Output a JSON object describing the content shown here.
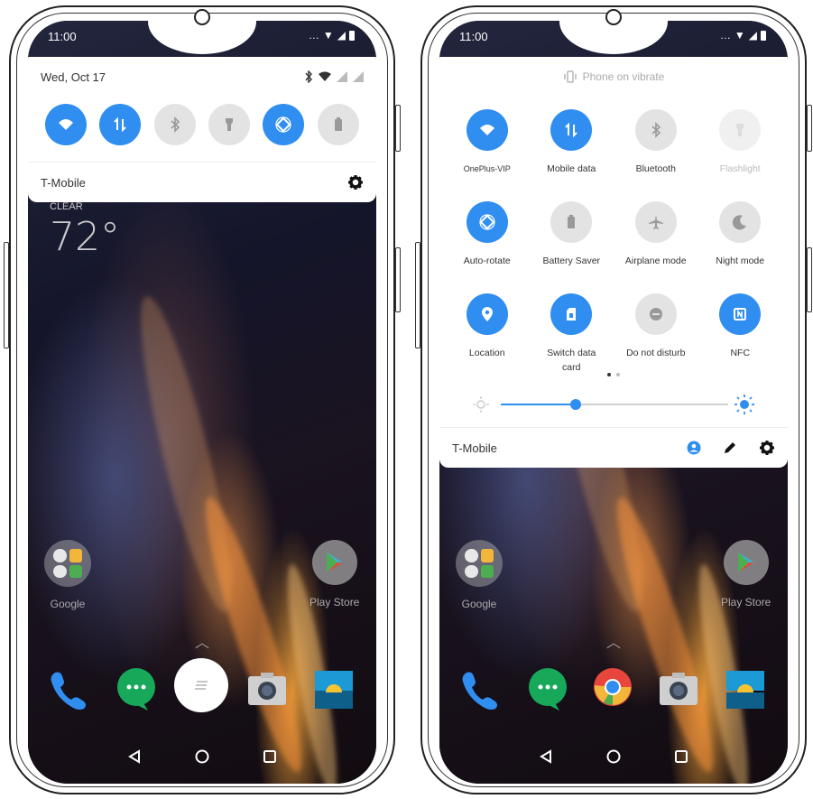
{
  "left_phone": {
    "status": {
      "time": "11:00"
    },
    "panel": {
      "date": "Wed, Oct 17",
      "tiles": [
        {
          "icon": "wifi-icon",
          "state": "on"
        },
        {
          "icon": "mobile-data-icon",
          "state": "on"
        },
        {
          "icon": "bluetooth-icon",
          "state": "off"
        },
        {
          "icon": "flashlight-icon",
          "state": "off"
        },
        {
          "icon": "auto-rotate-icon",
          "state": "on"
        },
        {
          "icon": "battery-saver-icon",
          "state": "off"
        }
      ],
      "carrier": "T-Mobile"
    },
    "weather": {
      "condition": "CLEAR",
      "temp": "72°"
    },
    "home_apps": [
      {
        "label": "Google"
      },
      {
        "label": "Play Store"
      }
    ]
  },
  "right_phone": {
    "status": {
      "time": "11:00"
    },
    "panel": {
      "vibrate_text": "Phone on vibrate",
      "tiles": [
        {
          "label": "OnePlus-VIP",
          "icon": "wifi-icon",
          "state": "on"
        },
        {
          "label": "Mobile data",
          "icon": "mobile-data-icon",
          "state": "on"
        },
        {
          "label": "Bluetooth",
          "icon": "bluetooth-icon",
          "state": "off"
        },
        {
          "label": "Flashlight",
          "icon": "flashlight-icon",
          "state": "dim"
        },
        {
          "label": "Auto-rotate",
          "icon": "auto-rotate-icon",
          "state": "on"
        },
        {
          "label": "Battery Saver",
          "icon": "battery-saver-icon",
          "state": "off"
        },
        {
          "label": "Airplane mode",
          "icon": "airplane-icon",
          "state": "off"
        },
        {
          "label": "Night mode",
          "icon": "night-mode-icon",
          "state": "off"
        },
        {
          "label": "Location",
          "icon": "location-icon",
          "state": "on"
        },
        {
          "label": "Switch data card",
          "icon": "sim-card-icon",
          "state": "on"
        },
        {
          "label": "Do not disturb",
          "icon": "do-not-disturb-icon",
          "state": "off"
        },
        {
          "label": "NFC",
          "icon": "nfc-icon",
          "state": "on"
        }
      ],
      "brightness": 0.33,
      "carrier": "T-Mobile"
    },
    "home_apps": [
      {
        "label": "Google"
      },
      {
        "label": "Play Store"
      }
    ]
  },
  "colors": {
    "accent": "#2f8ef0",
    "tile_off": "#e3e3e3"
  }
}
